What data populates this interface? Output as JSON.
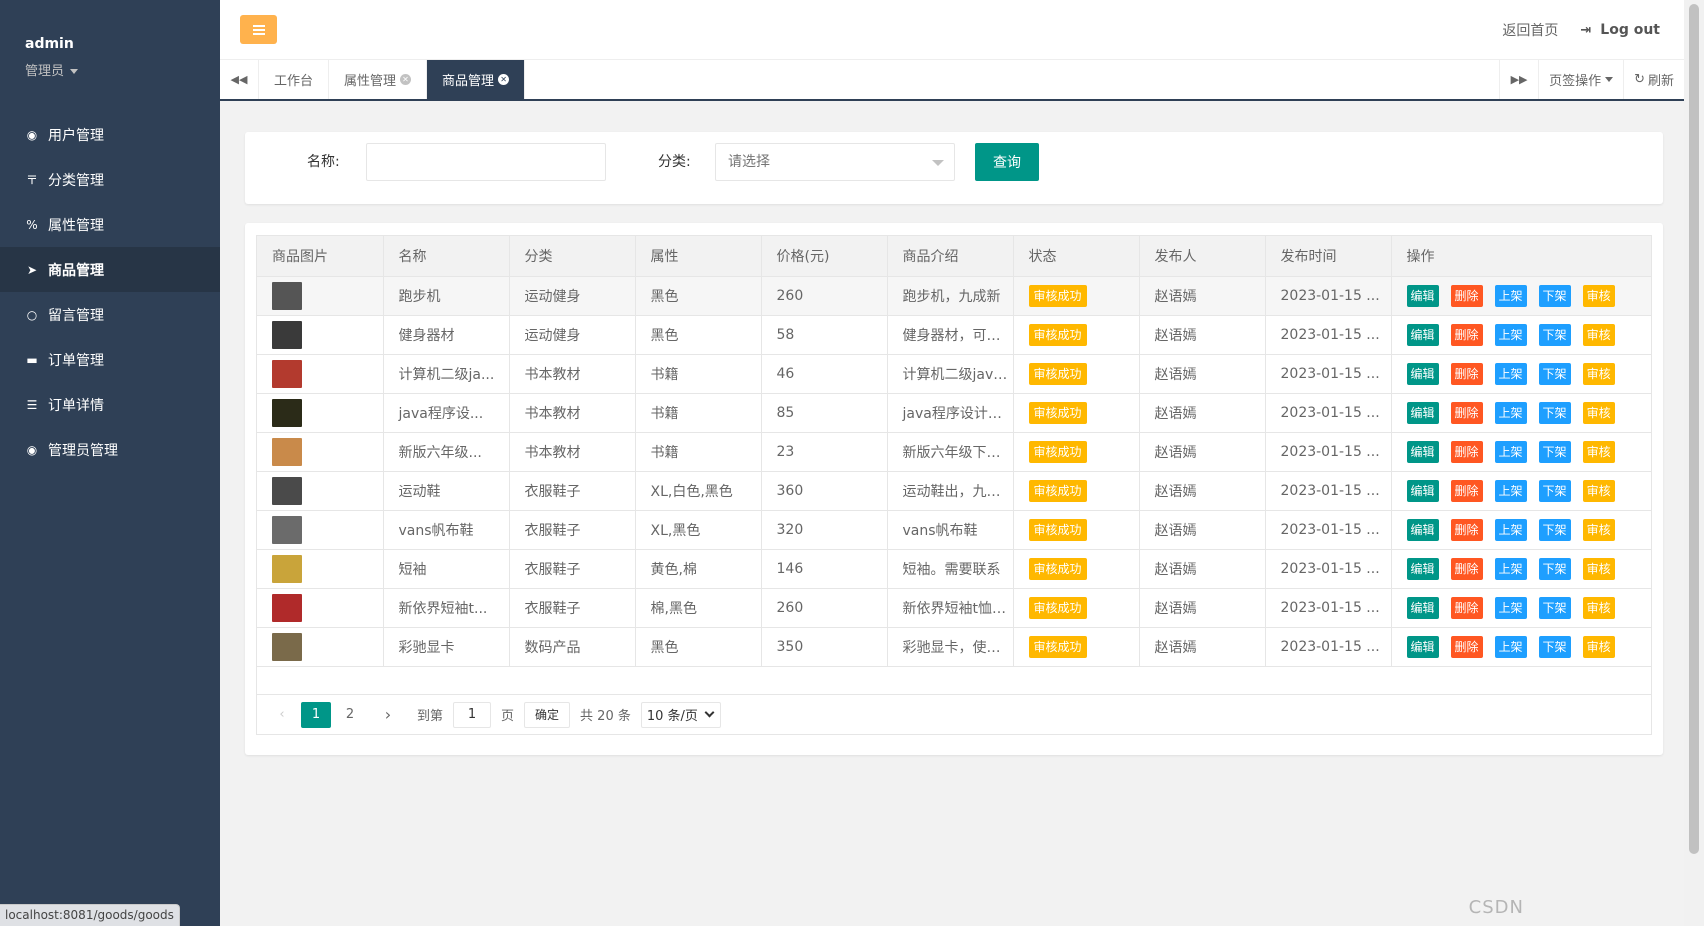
{
  "user": {
    "name": "admin",
    "role": "管理员"
  },
  "menu": [
    {
      "label": "用户管理",
      "icon": "user-circle-icon",
      "glyph": "◉"
    },
    {
      "label": "分类管理",
      "icon": "category-icon",
      "glyph": "〒"
    },
    {
      "label": "属性管理",
      "icon": "percent-icon",
      "glyph": "%"
    },
    {
      "label": "商品管理",
      "icon": "paper-plane-icon",
      "glyph": "➤"
    },
    {
      "label": "留言管理",
      "icon": "comment-icon",
      "glyph": "○"
    },
    {
      "label": "订单管理",
      "icon": "credit-card-icon",
      "glyph": "▬"
    },
    {
      "label": "订单详情",
      "icon": "sliders-icon",
      "glyph": "☰"
    },
    {
      "label": "管理员管理",
      "icon": "admin-user-icon",
      "glyph": "◉"
    }
  ],
  "header": {
    "home": "返回首页",
    "logout": "Log out"
  },
  "tabs": [
    {
      "label": "工作台",
      "closable": false
    },
    {
      "label": "属性管理",
      "closable": true
    },
    {
      "label": "商品管理",
      "closable": true
    }
  ],
  "tab_ops": {
    "pageops": "页签操作",
    "refresh": "刷新"
  },
  "search": {
    "name_label": "名称:",
    "name_value": "",
    "category_label": "分类:",
    "category_placeholder": "请选择",
    "query_button": "查询"
  },
  "table": {
    "headers": [
      "商品图片",
      "名称",
      "分类",
      "属性",
      "价格(元)",
      "商品介绍",
      "状态",
      "发布人",
      "发布时间",
      "操作"
    ],
    "rows": [
      {
        "img": "#555555",
        "name": "跑步机",
        "category": "运动健身",
        "attr": "黑色",
        "price": "260",
        "intro": "跑步机，九成新",
        "status": "审核成功",
        "publisher": "赵语嫣",
        "time": "2023-01-15 ..."
      },
      {
        "img": "#3a3a3a",
        "name": "健身器材",
        "category": "运动健身",
        "attr": "黑色",
        "price": "58",
        "intro": "健身器材，可以做",
        "status": "审核成功",
        "publisher": "赵语嫣",
        "time": "2023-01-15 ..."
      },
      {
        "img": "#b33a2e",
        "name": "计算机二级ja...",
        "category": "书本教材",
        "attr": "书籍",
        "price": "46",
        "intro": "计算机二级java教",
        "status": "审核成功",
        "publisher": "赵语嫣",
        "time": "2023-01-15 ..."
      },
      {
        "img": "#2b2b18",
        "name": "java程序设...",
        "category": "书本教材",
        "attr": "书籍",
        "price": "85",
        "intro": "java程序设计与问",
        "status": "审核成功",
        "publisher": "赵语嫣",
        "time": "2023-01-15 ..."
      },
      {
        "img": "#c98a4a",
        "name": "新版六年级...",
        "category": "书本教材",
        "attr": "书籍",
        "price": "23",
        "intro": "新版六年级下册同",
        "status": "审核成功",
        "publisher": "赵语嫣",
        "time": "2023-01-15 ..."
      },
      {
        "img": "#4a4a4a",
        "name": "运动鞋",
        "category": "衣服鞋子",
        "attr": "XL,白色,黑色",
        "price": "360",
        "intro": "运动鞋出，九成新",
        "status": "审核成功",
        "publisher": "赵语嫣",
        "time": "2023-01-15 ..."
      },
      {
        "img": "#6b6b6b",
        "name": "vans帆布鞋",
        "category": "衣服鞋子",
        "attr": "XL,黑色",
        "price": "320",
        "intro": "vans帆布鞋",
        "status": "审核成功",
        "publisher": "赵语嫣",
        "time": "2023-01-15 ..."
      },
      {
        "img": "#c9a43a",
        "name": "短袖",
        "category": "衣服鞋子",
        "attr": "黄色,棉",
        "price": "146",
        "intro": "短袖。需要联系",
        "status": "审核成功",
        "publisher": "赵语嫣",
        "time": "2023-01-15 ..."
      },
      {
        "img": "#b02a2a",
        "name": "新依界短袖t...",
        "category": "衣服鞋子",
        "attr": "棉,黑色",
        "price": "260",
        "intro": "新依界短袖t恤上衣",
        "status": "审核成功",
        "publisher": "赵语嫣",
        "time": "2023-01-15 ..."
      },
      {
        "img": "#7a6a4a",
        "name": "彩驰显卡",
        "category": "数码产品",
        "attr": "黑色",
        "price": "350",
        "intro": "彩驰显卡，使用一",
        "status": "审核成功",
        "publisher": "赵语嫣",
        "time": "2023-01-15 ..."
      }
    ],
    "actions": {
      "edit": "编辑",
      "delete": "删除",
      "up": "上架",
      "down": "下架",
      "audit": "审核"
    }
  },
  "pager": {
    "pages": [
      "1",
      "2"
    ],
    "current": "1",
    "goto_label": "到第",
    "goto_value": "1",
    "page_unit": "页",
    "confirm": "确定",
    "total": "共 20 条",
    "page_size": "10 条/页"
  },
  "status_url": "localhost:8081/goods/goods",
  "watermark": "CSDN"
}
